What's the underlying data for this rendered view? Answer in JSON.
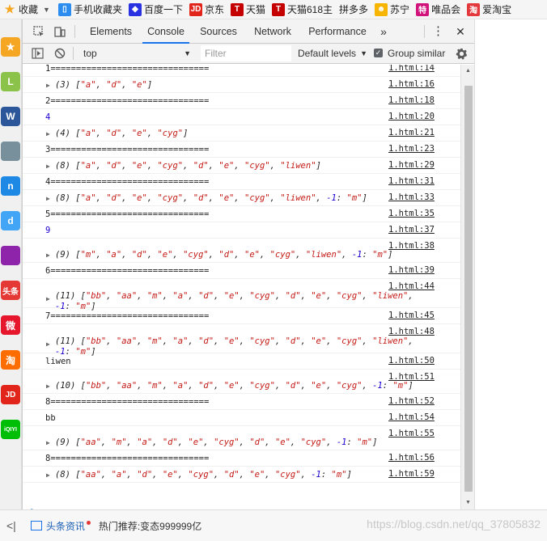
{
  "bookmarks": [
    {
      "label": "收藏",
      "icon": "star-icon",
      "color": "#f5a623"
    },
    {
      "label": "手机收藏夹",
      "icon": "phone-icon",
      "color": "#2d8cf0"
    },
    {
      "label": "百度一下",
      "icon": "baidu-paw-icon",
      "color": "#2932e1"
    },
    {
      "label": "京东",
      "icon": "jd-icon",
      "color": "#e1251b"
    },
    {
      "label": "天猫",
      "icon": "tmall-icon",
      "color": "#c40000"
    },
    {
      "label": "天猫618主",
      "icon": "tmall-icon",
      "color": "#c40000"
    },
    {
      "label": "拼多多",
      "icon": "",
      "color": ""
    },
    {
      "label": "苏宁",
      "icon": "suning-icon",
      "color": "#f8b500"
    },
    {
      "label": "唯品会",
      "icon": "vip-icon",
      "color": "#d1147b"
    },
    {
      "label": "爱淘宝",
      "icon": "taobao-icon",
      "color": "#e4393c"
    }
  ],
  "leftbar": [
    {
      "icon": "favorites-star-icon",
      "color": "#f5a623",
      "text": "★"
    },
    {
      "icon": "clock-app-icon",
      "color": "#8bc34a",
      "text": "L"
    },
    {
      "icon": "word-doc-icon",
      "color": "#2b579a",
      "text": "W"
    },
    {
      "icon": "game-app-icon",
      "color": "#78909c",
      "text": ""
    },
    {
      "icon": "app-icon",
      "color": "#1e88e5",
      "text": "n"
    },
    {
      "icon": "d-app-icon",
      "color": "#42a5f5",
      "text": "d"
    },
    {
      "icon": "game-character-icon",
      "color": "#8e24aa",
      "text": ""
    },
    {
      "icon": "toutiao-icon",
      "color": "#e53935",
      "text": "头条"
    },
    {
      "icon": "weibo-icon",
      "color": "#e6162d",
      "text": "微"
    },
    {
      "icon": "taobao-side-icon",
      "color": "#ff6d00",
      "text": "淘"
    },
    {
      "icon": "jd-side-icon",
      "color": "#e1251b",
      "text": "JD"
    },
    {
      "icon": "iqiyi-icon",
      "color": "#00be06",
      "text": "iQIYI"
    }
  ],
  "devtools": {
    "tabs": [
      "Elements",
      "Console",
      "Sources",
      "Network",
      "Performance"
    ],
    "more": "»",
    "menu": "⋮",
    "close": "✕",
    "context": "top",
    "filter_placeholder": "Filter",
    "levels": "Default levels",
    "group_similar": "Group similar"
  },
  "console": {
    "prompt": ">",
    "rows": [
      {
        "type": "sep",
        "text": "1===============================",
        "src": "1.html:14"
      },
      {
        "type": "arr",
        "n": 3,
        "items": [
          "\"a\"",
          "\"d\"",
          "\"e\""
        ],
        "src": "1.html:16"
      },
      {
        "type": "sep",
        "text": "2===============================",
        "src": "1.html:18"
      },
      {
        "type": "num",
        "text": "4",
        "src": "1.html:20"
      },
      {
        "type": "arr",
        "n": 4,
        "items": [
          "\"a\"",
          "\"d\"",
          "\"e\"",
          "\"cyg\""
        ],
        "src": "1.html:21"
      },
      {
        "type": "sep",
        "text": "3===============================",
        "src": "1.html:23"
      },
      {
        "type": "arr",
        "n": 8,
        "items": [
          "\"a\"",
          "\"d\"",
          "\"e\"",
          "\"cyg\"",
          "\"d\"",
          "\"e\"",
          "\"cyg\"",
          "\"liwen\""
        ],
        "src": "1.html:29"
      },
      {
        "type": "sep",
        "text": "4===============================",
        "src": "1.html:31"
      },
      {
        "type": "arr",
        "n": 8,
        "items": [
          "\"a\"",
          "\"d\"",
          "\"e\"",
          "\"cyg\"",
          "\"d\"",
          "\"e\"",
          "\"cyg\"",
          "\"liwen\"",
          "-1: \"m\""
        ],
        "src": "1.html:33"
      },
      {
        "type": "sep",
        "text": "5===============================",
        "src": "1.html:35"
      },
      {
        "type": "num",
        "text": "9",
        "src": "1.html:37"
      },
      {
        "type": "arr",
        "n": 9,
        "items": [
          "\"m\"",
          "\"a\"",
          "\"d\"",
          "\"e\"",
          "\"cyg\"",
          "\"d\"",
          "\"e\"",
          "\"cyg\"",
          "\"liwen\"",
          "-1: \"m\""
        ],
        "src": "1.html:38",
        "tall": true
      },
      {
        "type": "sep",
        "text": "6===============================",
        "src": "1.html:39"
      },
      {
        "type": "arr",
        "n": 11,
        "items": [
          "\"bb\"",
          "\"aa\"",
          "\"m\"",
          "\"a\"",
          "\"d\"",
          "\"e\"",
          "\"cyg\"",
          "\"d\"",
          "\"e\"",
          "\"cyg\"",
          "\"liwen\"",
          "-1: \"m\""
        ],
        "src": "1.html:44",
        "tall": true,
        "wrap": true
      },
      {
        "type": "sep",
        "text": "7===============================",
        "src": "1.html:45"
      },
      {
        "type": "arr",
        "n": 11,
        "items": [
          "\"bb\"",
          "\"aa\"",
          "\"m\"",
          "\"a\"",
          "\"d\"",
          "\"e\"",
          "\"cyg\"",
          "\"d\"",
          "\"e\"",
          "\"cyg\"",
          "\"liwen\"",
          "-1: \"m\""
        ],
        "src": "1.html:48",
        "tall": true,
        "wrap": true
      },
      {
        "type": "text",
        "text": "liwen",
        "src": "1.html:50"
      },
      {
        "type": "arr",
        "n": 10,
        "items": [
          "\"bb\"",
          "\"aa\"",
          "\"m\"",
          "\"a\"",
          "\"d\"",
          "\"e\"",
          "\"cyg\"",
          "\"d\"",
          "\"e\"",
          "\"cyg\"",
          "-1: \"m\""
        ],
        "src": "1.html:51",
        "tall": true
      },
      {
        "type": "sep",
        "text": "8===============================",
        "src": "1.html:52"
      },
      {
        "type": "text",
        "text": "bb",
        "src": "1.html:54"
      },
      {
        "type": "arr",
        "n": 9,
        "items": [
          "\"aa\"",
          "\"m\"",
          "\"a\"",
          "\"d\"",
          "\"e\"",
          "\"cyg\"",
          "\"d\"",
          "\"e\"",
          "\"cyg\"",
          "-1: \"m\""
        ],
        "src": "1.html:55",
        "tall": true
      },
      {
        "type": "sep",
        "text": "8===============================",
        "src": "1.html:56"
      },
      {
        "type": "arr",
        "n": 8,
        "items": [
          "\"aa\"",
          "\"a\"",
          "\"d\"",
          "\"e\"",
          "\"cyg\"",
          "\"d\"",
          "\"e\"",
          "\"cyg\"",
          "-1: \"m\""
        ],
        "src": "1.html:59"
      }
    ]
  },
  "statusbar": {
    "news": "头条资讯",
    "hot_prefix": "热门推荐:",
    "hot": "变态999999亿",
    "watermark": "https://blog.csdn.net/qq_37805832"
  }
}
